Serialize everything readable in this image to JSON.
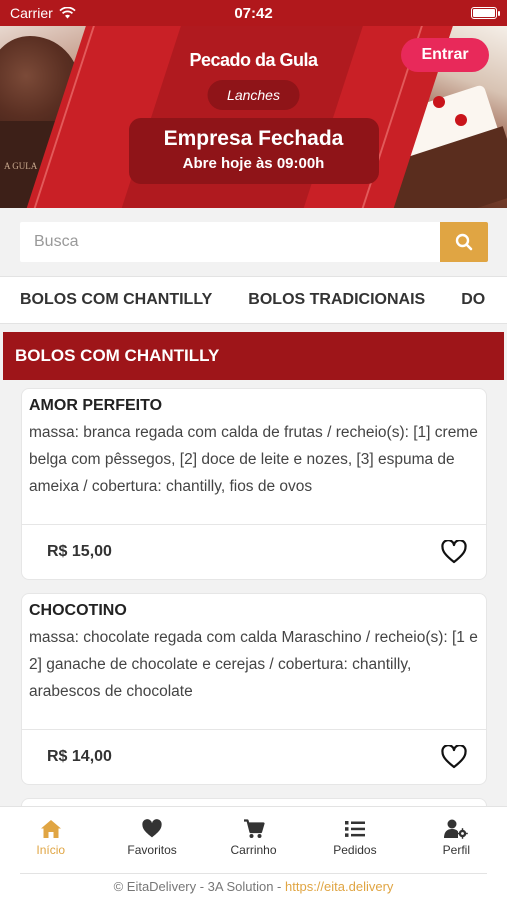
{
  "status_bar": {
    "carrier": "Carrier",
    "time": "07:42"
  },
  "banner": {
    "brand": "Pecado da Gula",
    "login_label": "Entrar",
    "category": "Lanches",
    "closed_title": "Empresa Fechada",
    "closed_subtitle": "Abre hoje às 09:00h",
    "cup_text": "A GULA"
  },
  "search": {
    "placeholder": "Busca"
  },
  "tabs": [
    "BOLOS COM CHANTILLY",
    "BOLOS TRADICIONAIS",
    "DO"
  ],
  "section": {
    "title": "BOLOS COM CHANTILLY"
  },
  "products": [
    {
      "name": "AMOR PERFEITO",
      "description": "massa: branca regada com calda de frutas / recheio(s): [1] creme belga com pêssegos, [2] doce de leite e nozes, [3] espuma de ameixa / cobertura: chantilly, fios de ovos",
      "price": "R$ 15,00"
    },
    {
      "name": "CHOCOTINO",
      "description": "massa: chocolate regada com calda Maraschino / recheio(s): [1 e 2] ganache de chocolate e cerejas / cobertura: chantilly, arabescos de chocolate",
      "price": "R$ 14,00"
    }
  ],
  "nav": [
    {
      "label": "Início",
      "icon": "home-icon",
      "active": true
    },
    {
      "label": "Favoritos",
      "icon": "heart-icon",
      "active": false
    },
    {
      "label": "Carrinho",
      "icon": "cart-icon",
      "active": false
    },
    {
      "label": "Pedidos",
      "icon": "list-icon",
      "active": false
    },
    {
      "label": "Perfil",
      "icon": "user-gear-icon",
      "active": false
    }
  ],
  "footer": {
    "text": "© EitaDelivery - 3A Solution - ",
    "link": "https://eita.delivery"
  },
  "colors": {
    "brand_red": "#b01a1f",
    "section_red": "#9e1519",
    "accent": "#e0a543",
    "login_pink": "#e8295a"
  }
}
